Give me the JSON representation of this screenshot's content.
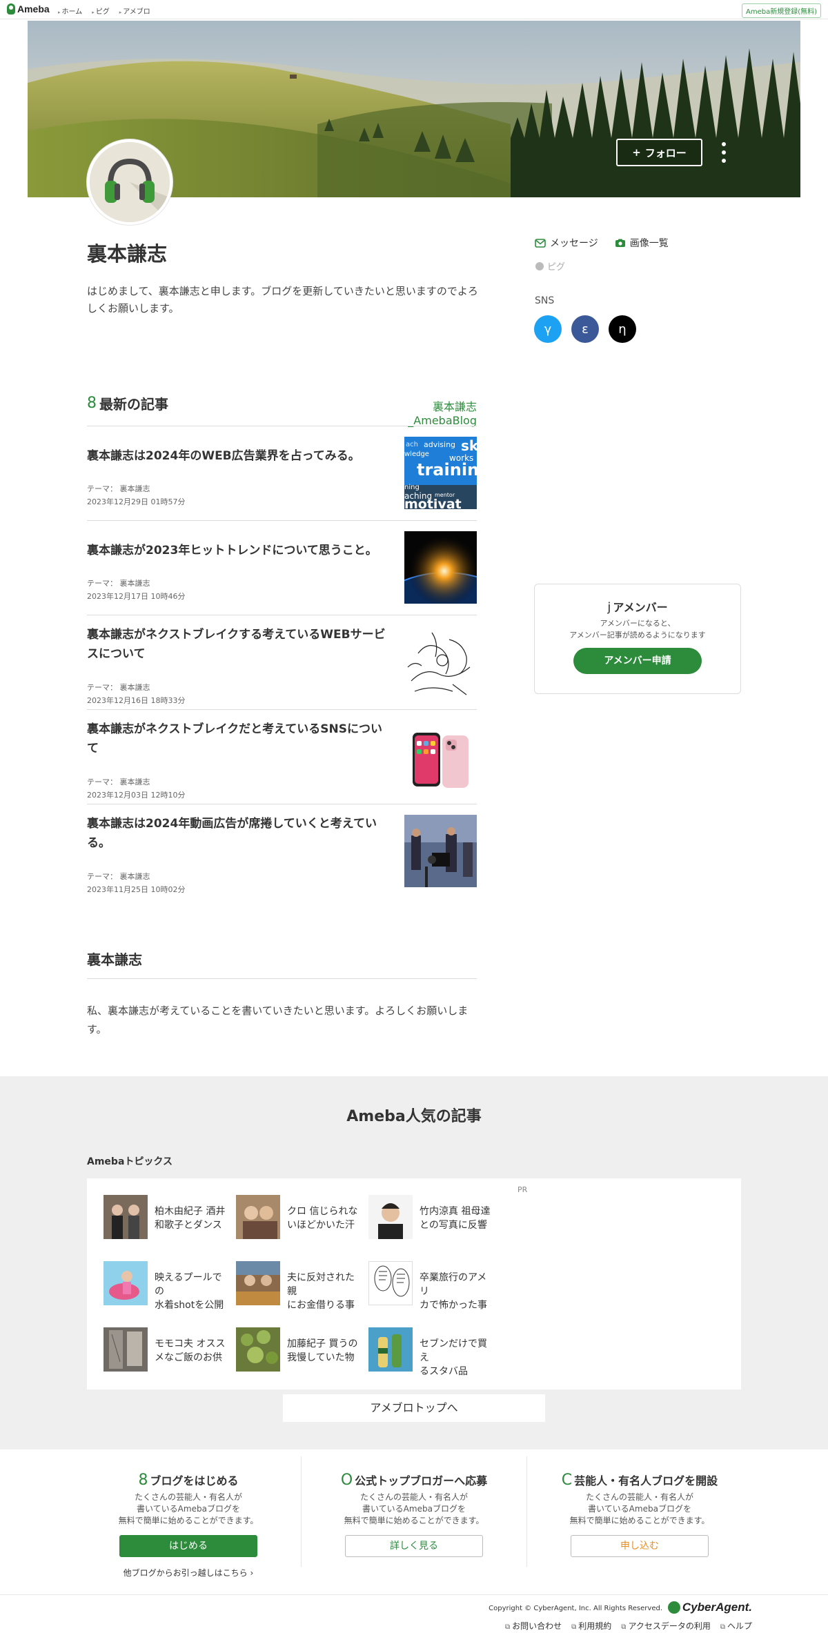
{
  "header": {
    "logo": "Ameba",
    "nav": [
      "ホーム",
      "ピグ",
      "アメブロ"
    ],
    "signup": "Ameba新規登録(無料)"
  },
  "hero": {
    "follow_label": "フォロー",
    "follow_plus": "+"
  },
  "profile": {
    "name": "裏本謙志",
    "bio": "はじめまして、裏本謙志と申します。ブログを更新していきたいと思いますのでよろしくお願いします。",
    "links": {
      "message": "メッセージ",
      "images": "画像一覧",
      "pigg": "ピグ"
    },
    "sns_label": "SNS",
    "sns": [
      {
        "glyph": "γ",
        "color": "#1da1f2",
        "icon": "twitter-icon"
      },
      {
        "glyph": "ε",
        "color": "#3b5998",
        "icon": "facebook-icon"
      },
      {
        "glyph": "η",
        "color": "#000000",
        "icon": "tiktok-icon"
      }
    ]
  },
  "latest": {
    "icon": "8",
    "title": "最新の記事",
    "blog_link": "裏本謙志_AmebaBlog",
    "articles": [
      {
        "title": "裏本謙志は2024年のWEB広告業界を占ってみる。",
        "theme": "テーマ： 裏本謙志",
        "date": "2023年12月29日 01時57分",
        "thumb": "training-words"
      },
      {
        "title": "裏本謙志が2023年ヒットトレンドについて思うこと。",
        "theme": "テーマ： 裏本謙志",
        "date": "2023年12月17日 10時46分",
        "thumb": "earth-sunrise"
      },
      {
        "title": "裏本謙志がネクストブレイクする考えているWEBサービスについて",
        "theme": "テーマ： 裏本謙志",
        "date": "2023年12月16日 18時33分",
        "thumb": "sketch"
      },
      {
        "title": "裏本謙志がネクストブレイクだと考えているSNSについて",
        "theme": "テーマ： 裏本謙志",
        "date": "2023年12月03日 12時10分",
        "thumb": "smartphones"
      },
      {
        "title": "裏本謙志は2024年動画広告が席捲していくと考えている。",
        "theme": "テーマ： 裏本謙志",
        "date": "2023年11月25日 10時02分",
        "thumb": "video-shoot"
      }
    ]
  },
  "about": {
    "title": "裏本謙志",
    "text": "私、裏本謙志が考えていることを書いていきたいと思います。よろしくお願いします。"
  },
  "amember": {
    "icon": "j",
    "title": "アメンバー",
    "desc_line1": "アメンバーになると、",
    "desc_line2": "アメンバー記事が読めるようになります",
    "button": "アメンバー申請"
  },
  "popular": {
    "title": "Ameba人気の記事",
    "topics_label": "Amebaトピックス",
    "pr": "PR",
    "topics": [
      {
        "line1": "柏木由紀子 酒井",
        "line2": "和歌子とダンス",
        "thumb": "#7a6a5c"
      },
      {
        "line1": "クロ 信じられな",
        "line2": "いほどかいた汗",
        "thumb": "#a88a6a"
      },
      {
        "line1": "竹内涼真 祖母達",
        "line2": "との写真に反響",
        "thumb": "#3b3430"
      },
      {
        "line1": "映えるプールでの",
        "line2": "水着shotを公開",
        "thumb": "#e58fae"
      },
      {
        "line1": "夫に反対された親",
        "line2": "にお金借りる事",
        "thumb": "#8a6a4a"
      },
      {
        "line1": "卒業旅行のアメリ",
        "line2": "カで怖かった事",
        "thumb": "#dddddd"
      },
      {
        "line1": "モモコ夫 オスス",
        "line2": "メなご飯のお供",
        "thumb": "#6f6a64"
      },
      {
        "line1": "加藤紀子 買うの",
        "line2": "我慢していた物",
        "thumb": "#6a7a3a"
      },
      {
        "line1": "セブンだけで買え",
        "line2": "るスタバ品",
        "thumb": "#3d8f5a"
      }
    ],
    "to_top": "アメブロトップへ"
  },
  "cta": [
    {
      "icon": "8",
      "title": "ブログをはじめる",
      "d1": "たくさんの芸能人・有名人が",
      "d2": "書いているAmebaブログを",
      "d3": "無料で簡単に始めることができます。",
      "button": "はじめる",
      "sub": "他ブログからお引っ越しはこちら"
    },
    {
      "icon": "O",
      "title": "公式トップブロガーへ応募",
      "d1": "たくさんの芸能人・有名人が",
      "d2": "書いているAmebaブログを",
      "d3": "無料で簡単に始めることができます。",
      "button": "詳しく見る"
    },
    {
      "icon": "C",
      "title": "芸能人・有名人ブログを開設",
      "d1": "たくさんの芸能人・有名人が",
      "d2": "書いているAmebaブログを",
      "d3": "無料で簡単に始めることができます。",
      "button": "申し込む"
    }
  ],
  "footer": {
    "copyright": "Copyright © CyberAgent, Inc. All Rights Reserved.",
    "brand": "CyberAgent.",
    "links": [
      "お問い合わせ",
      "利用規約",
      "アクセスデータの利用",
      "ヘルプ"
    ]
  },
  "colors": {
    "accent": "#2d8c3c",
    "orange": "#e88d24",
    "popular_bg": "#efefef"
  }
}
